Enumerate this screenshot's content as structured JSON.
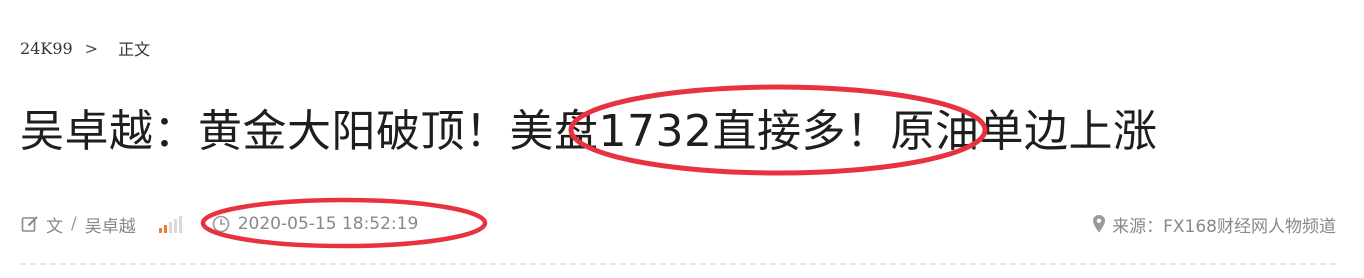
{
  "breadcrumb": {
    "home": "24K99",
    "separator": ">",
    "current": "正文"
  },
  "article": {
    "title": "吴卓越：黄金大阳破顶！美盘1732直接多！原油单边上涨"
  },
  "meta": {
    "author_prefix": "文",
    "author_separator": "/",
    "author_name": "吴卓越",
    "datetime": "2020-05-15 18:52:19",
    "source": "来源：FX168财经网人物频道",
    "icons": {
      "author": "edit-icon",
      "popularity": "signal-bars-icon",
      "time": "clock-icon",
      "source": "map-pin-icon"
    }
  },
  "colors": {
    "annotation": "#e8333f",
    "signal_active": "#f07c2c",
    "meta_text": "#888888"
  }
}
